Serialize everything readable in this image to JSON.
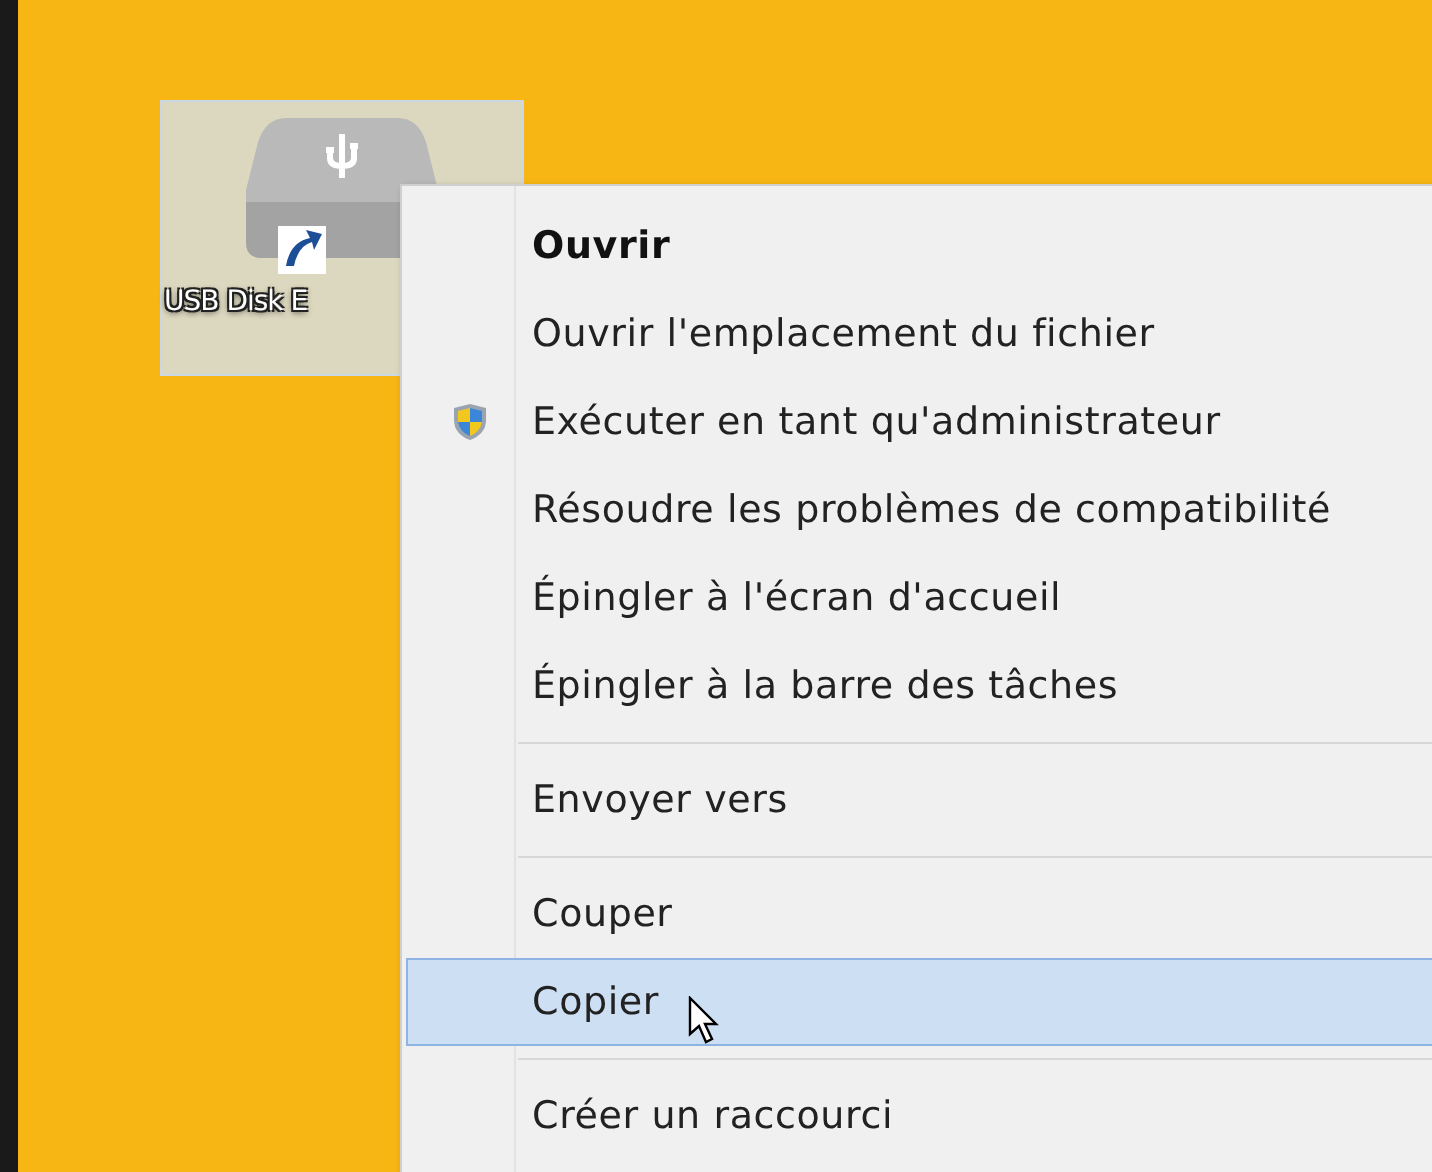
{
  "desktop_icon": {
    "label": "USB Disk E",
    "selected": true
  },
  "context_menu": {
    "items": [
      {
        "kind": "item",
        "label": "Ouvrir",
        "default": true,
        "selected": false
      },
      {
        "kind": "item",
        "label": "Ouvrir l'emplacement du fichier",
        "default": false,
        "selected": false
      },
      {
        "kind": "elevated",
        "label": "Exécuter en tant qu'administrateur",
        "default": false,
        "selected": false
      },
      {
        "kind": "item",
        "label": "Résoudre les problèmes de compatibilité",
        "default": false,
        "selected": false
      },
      {
        "kind": "item",
        "label": "Épingler à l'écran d'accueil",
        "default": false,
        "selected": false
      },
      {
        "kind": "item",
        "label": "Épingler à la barre des tâches",
        "default": false,
        "selected": false
      },
      {
        "kind": "separator"
      },
      {
        "kind": "item",
        "label": "Envoyer vers",
        "default": false,
        "selected": false
      },
      {
        "kind": "separator"
      },
      {
        "kind": "item",
        "label": "Couper",
        "default": false,
        "selected": false
      },
      {
        "kind": "item",
        "label": "Copier",
        "default": false,
        "selected": true
      },
      {
        "kind": "separator"
      },
      {
        "kind": "item",
        "label": "Créer un raccourci",
        "default": false,
        "selected": false
      }
    ]
  }
}
